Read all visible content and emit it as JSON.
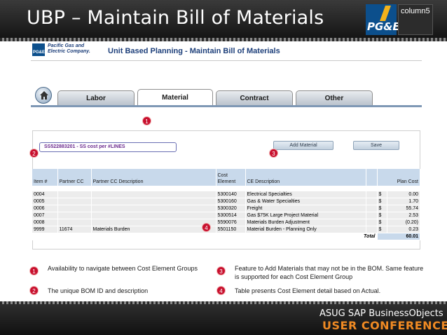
{
  "slide": {
    "title": "UBP – Maintain Bill of Materials",
    "logo_pge": "PG&E",
    "logo_column5": "column5"
  },
  "app": {
    "company_line1": "Pacific Gas and",
    "company_line2": "Electric Company.",
    "logo_small": "PG&E",
    "heading": "Unit Based Planning  - Maintain  Bill of Materials",
    "tabs": [
      {
        "label": "Labor"
      },
      {
        "label": "Material"
      },
      {
        "label": "Contract"
      },
      {
        "label": "Other"
      }
    ],
    "bom_id": "SS522883201 - SS cost per #LINES",
    "add_material_label": "Add Material",
    "save_label": "Save"
  },
  "table": {
    "headers": {
      "item": "Item #",
      "partner_cc": "Partner CC",
      "partner_cc_desc": "Partner CC Description",
      "cost_element": "Cost Element",
      "ce_description": "CE Description",
      "plan_cost": "Plan Cost"
    },
    "rows": [
      {
        "item": "0004",
        "partner_cc": "",
        "partner_cc_desc": "",
        "cost_element": "5300140",
        "ce_description": "Electrical Specialties",
        "currency": "$",
        "plan_cost": "0.00"
      },
      {
        "item": "0005",
        "partner_cc": "",
        "partner_cc_desc": "",
        "cost_element": "5300160",
        "ce_description": "Gas & Water Specialties",
        "currency": "$",
        "plan_cost": "1.70"
      },
      {
        "item": "0006",
        "partner_cc": "",
        "partner_cc_desc": "",
        "cost_element": "5300320",
        "ce_description": "Freight",
        "currency": "$",
        "plan_cost": "55.74"
      },
      {
        "item": "0007",
        "partner_cc": "",
        "partner_cc_desc": "",
        "cost_element": "5300514",
        "ce_description": "Gas $75K Large Project Material",
        "currency": "$",
        "plan_cost": "2.53"
      },
      {
        "item": "0008",
        "partner_cc": "",
        "partner_cc_desc": "",
        "cost_element": "5590076",
        "ce_description": "Materials Burden Adjustment",
        "currency": "$",
        "plan_cost": "(0.20)"
      },
      {
        "item": "9999",
        "partner_cc": "11674",
        "partner_cc_desc": "Materials Burden",
        "cost_element": "5501150",
        "ce_description": "Material Burden - Planning Only",
        "currency": "$",
        "plan_cost": "0.23"
      }
    ],
    "total_label": "Total",
    "total_value": "60.01"
  },
  "badges": {
    "b1": "1",
    "b2": "2",
    "b3": "3",
    "b4": "4"
  },
  "legend": {
    "item1": "Availability to navigate between Cost Element Groups",
    "item2": "The unique BOM ID and description",
    "item3": "Feature to Add Materials that may not be in the BOM.  Same feature is supported for each Cost Element Group",
    "item4": "Table presents Cost Element detail based on Actual."
  },
  "footer": {
    "line1": "ASUG SAP BusinessObjects",
    "line2": "USER CONFERENCE"
  },
  "colors": {
    "badge": "#c8102e",
    "header_fill": "#c8d9eb",
    "heading_text": "#1d3f7a",
    "conference_orange": "#f08a23"
  }
}
